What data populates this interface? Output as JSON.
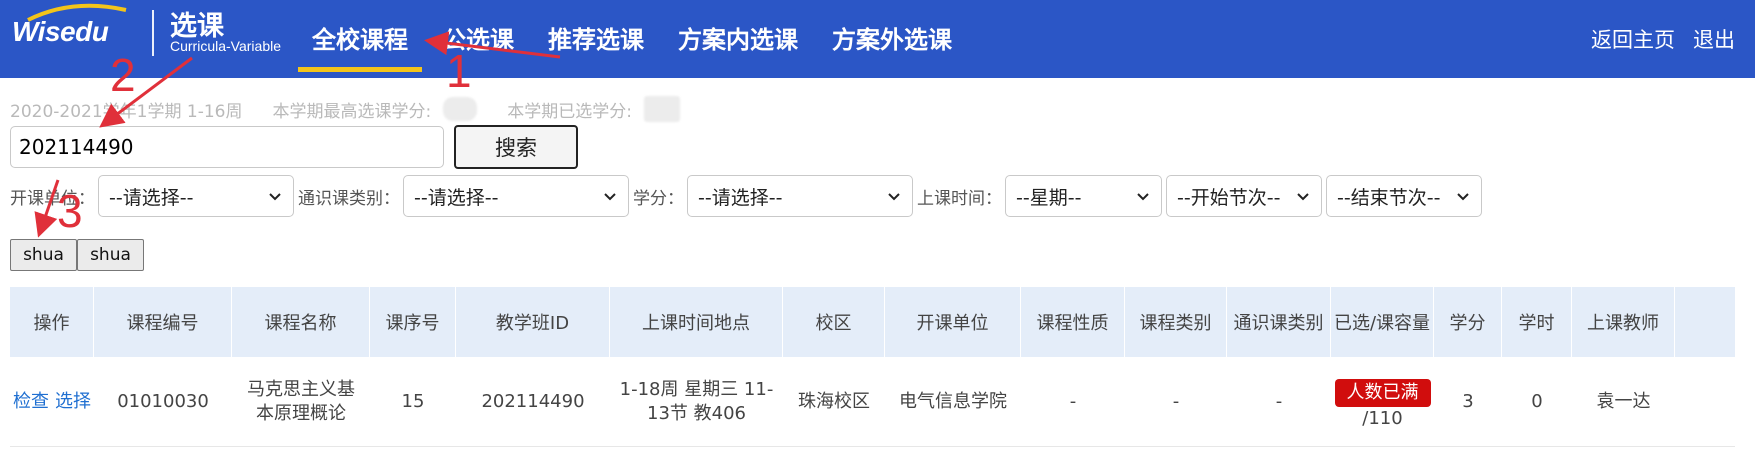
{
  "header": {
    "logo_text": "Wisedu",
    "title": "选课",
    "subtitle": "Curricula-Variable",
    "nav": [
      "全校课程",
      "公选课",
      "推荐选课",
      "方案内选课",
      "方案外选课"
    ],
    "active_tab": "全校课程",
    "right_links": [
      "返回主页",
      "退出"
    ]
  },
  "semester": {
    "term": "2020-2021学年1学期 1-16周",
    "max_credit_label": "本学期最高选课学分:",
    "selected_credit_label": "本学期已选学分:"
  },
  "search": {
    "value": "202114490",
    "button_label": "搜索"
  },
  "filters": [
    {
      "label": "开课单位：",
      "value": "--请选择--"
    },
    {
      "label": "通识课类别：",
      "value": "--请选择--"
    },
    {
      "label": "学分：",
      "value": "--请选择--"
    },
    {
      "label": "上课时间：",
      "value": "--星期--"
    },
    {
      "label": "",
      "value": "--开始节次--"
    },
    {
      "label": "",
      "value": "--结束节次--"
    }
  ],
  "actions": [
    "shua",
    "shua"
  ],
  "table": {
    "headers": [
      "操作",
      "课程编号",
      "课程名称",
      "课序号",
      "教学班ID",
      "上课时间地点",
      "校区",
      "开课单位",
      "课程性质",
      "课程类别",
      "通识课类别",
      "已选/课容量",
      "学分",
      "学时",
      "上课教师"
    ],
    "rows": [
      {
        "ops": [
          "检查",
          "选择"
        ],
        "course_no": "01010030",
        "course_name": "马克思主义基本原理概论",
        "seq": "15",
        "class_id": "202114490",
        "time_place": "1-18周 星期三 11-13节 教406",
        "campus": "珠海校区",
        "dept": "电气信息学院",
        "nature": "-",
        "category": "-",
        "ge_category": "-",
        "capacity_status": "人数已满",
        "capacity": "/110",
        "credit": "3",
        "hours": "0",
        "teacher": "袁一达"
      }
    ]
  },
  "annotations": [
    "1",
    "2",
    "3"
  ],
  "colors": {
    "header_bg": "#2b56c6",
    "active_underline": "#f3c41a",
    "table_header_bg": "#e4edf9",
    "badge_red": "#d10d0d",
    "link_blue": "#1f6fd1",
    "annotation_red": "#e0303a"
  }
}
